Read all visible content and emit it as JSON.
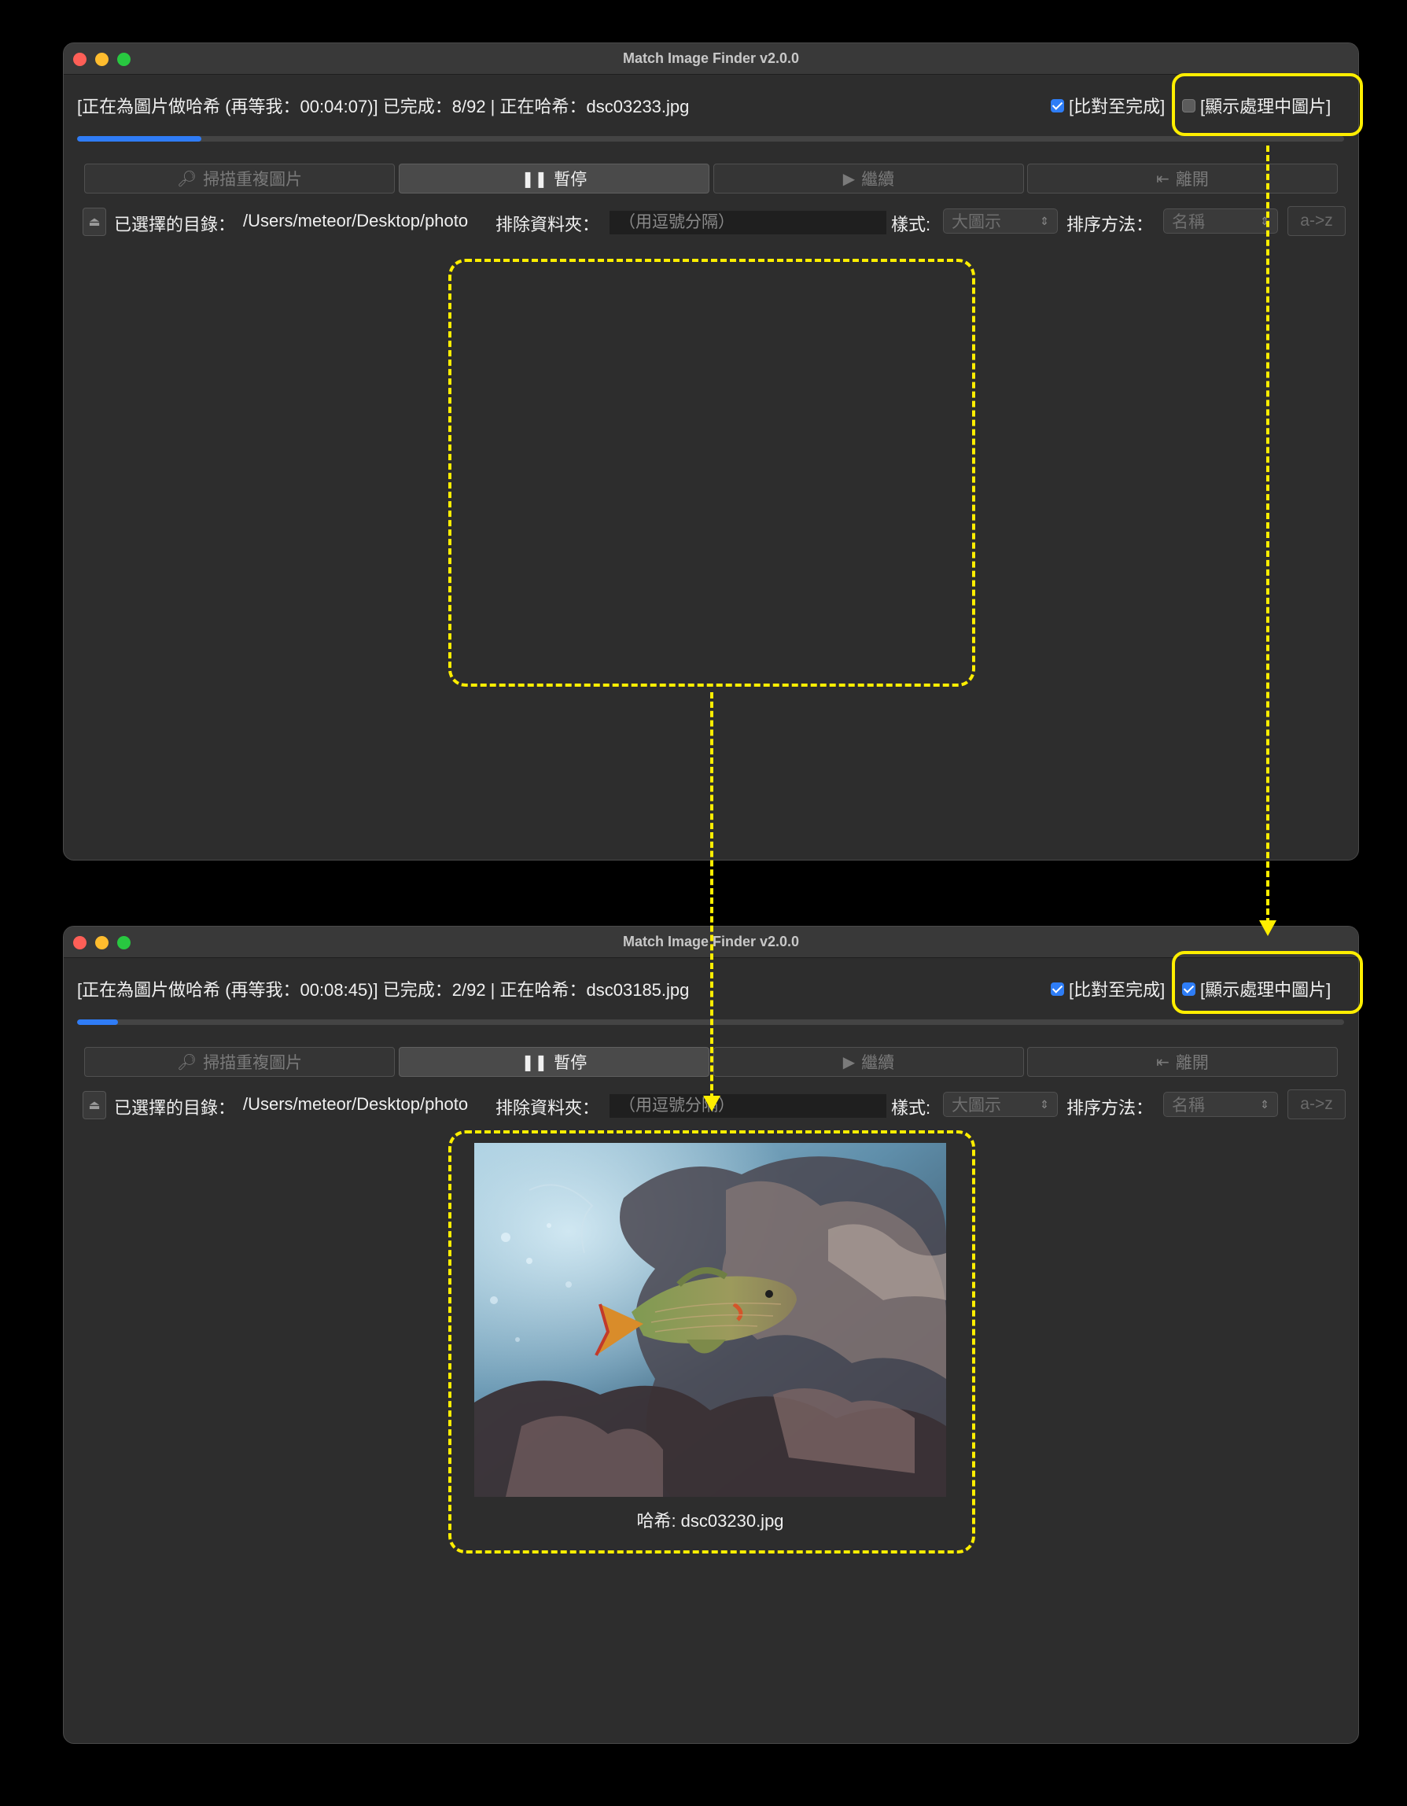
{
  "app_title": "Match Image Finder v2.0.0",
  "windows": [
    {
      "status": "[正在為圖片做哈希 (再等我：00:04:07)] 已完成：8/92 | 正在哈希：dsc03233.jpg",
      "compare_label": "[比對至完成]",
      "compare_checked": true,
      "show_label": "[顯示處理中圖片]",
      "show_checked": false,
      "progress_fraction": 0.098
    },
    {
      "status": "[正在為圖片做哈希 (再等我：00:08:45)] 已完成：2/92 | 正在哈希：dsc03185.jpg",
      "compare_label": "[比對至完成]",
      "compare_checked": true,
      "show_label": "[顯示處理中圖片]",
      "show_checked": true,
      "progress_fraction": 0.032,
      "preview_caption": "哈希: dsc03230.jpg"
    }
  ],
  "toolbar": {
    "scan_label": "掃描重複圖片",
    "pause_label": "暫停",
    "resume_label": "繼續",
    "exit_label": "離開"
  },
  "options": {
    "dir_label": "已選擇的目錄：",
    "dir_value": "/Users/meteor/Desktop/photo",
    "exclude_label": "排除資料夾：",
    "exclude_placeholder": "（用逗號分隔）",
    "style_label": "樣式:",
    "style_value": "大圖示",
    "sort_label": "排序方法：",
    "sort_value": "名稱",
    "order_label": "a->z"
  },
  "icons": {
    "scan": "magnifier-icon",
    "pause": "pause-icon",
    "resume": "play-icon",
    "exit": "exit-icon",
    "eject": "eject-icon"
  },
  "colors": {
    "highlight": "#ffee00",
    "accent": "#2f7cf6",
    "window_bg": "#2d2d2d"
  }
}
